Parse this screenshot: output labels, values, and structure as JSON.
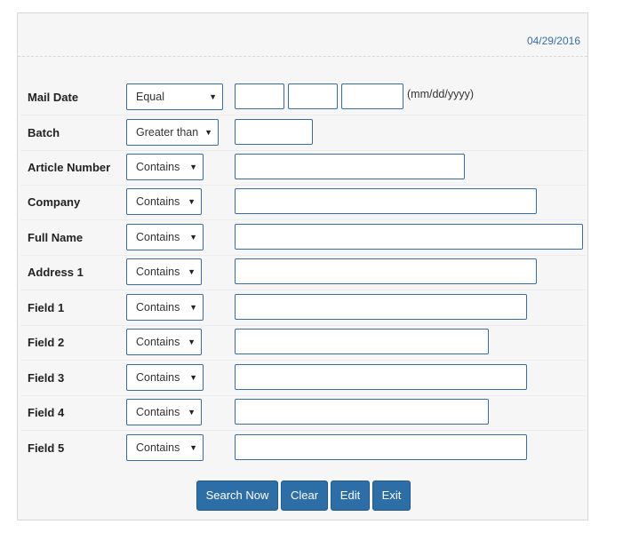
{
  "header": {
    "date": "04/29/2016"
  },
  "form": {
    "rows": [
      {
        "label": "Mail Date",
        "operator": "Equal",
        "hint": "(mm/dd/yyyy)"
      },
      {
        "label": "Batch",
        "operator": "Greater than"
      },
      {
        "label": "Article Number",
        "operator": "Contains"
      },
      {
        "label": "Company",
        "operator": "Contains"
      },
      {
        "label": "Full Name",
        "operator": "Contains"
      },
      {
        "label": "Address 1",
        "operator": "Contains"
      },
      {
        "label": "Field 1",
        "operator": "Contains"
      },
      {
        "label": "Field 2",
        "operator": "Contains"
      },
      {
        "label": "Field 3",
        "operator": "Contains"
      },
      {
        "label": "Field 4",
        "operator": "Contains"
      },
      {
        "label": "Field 5",
        "operator": "Contains"
      }
    ],
    "arrow": "▼"
  },
  "buttons": {
    "search": "Search Now",
    "clear": "Clear",
    "edit": "Edit",
    "exit": "Exit"
  },
  "colors": {
    "accent": "#2d6ea6",
    "border": "#3c6aa2",
    "date": "#3a6ea5"
  }
}
